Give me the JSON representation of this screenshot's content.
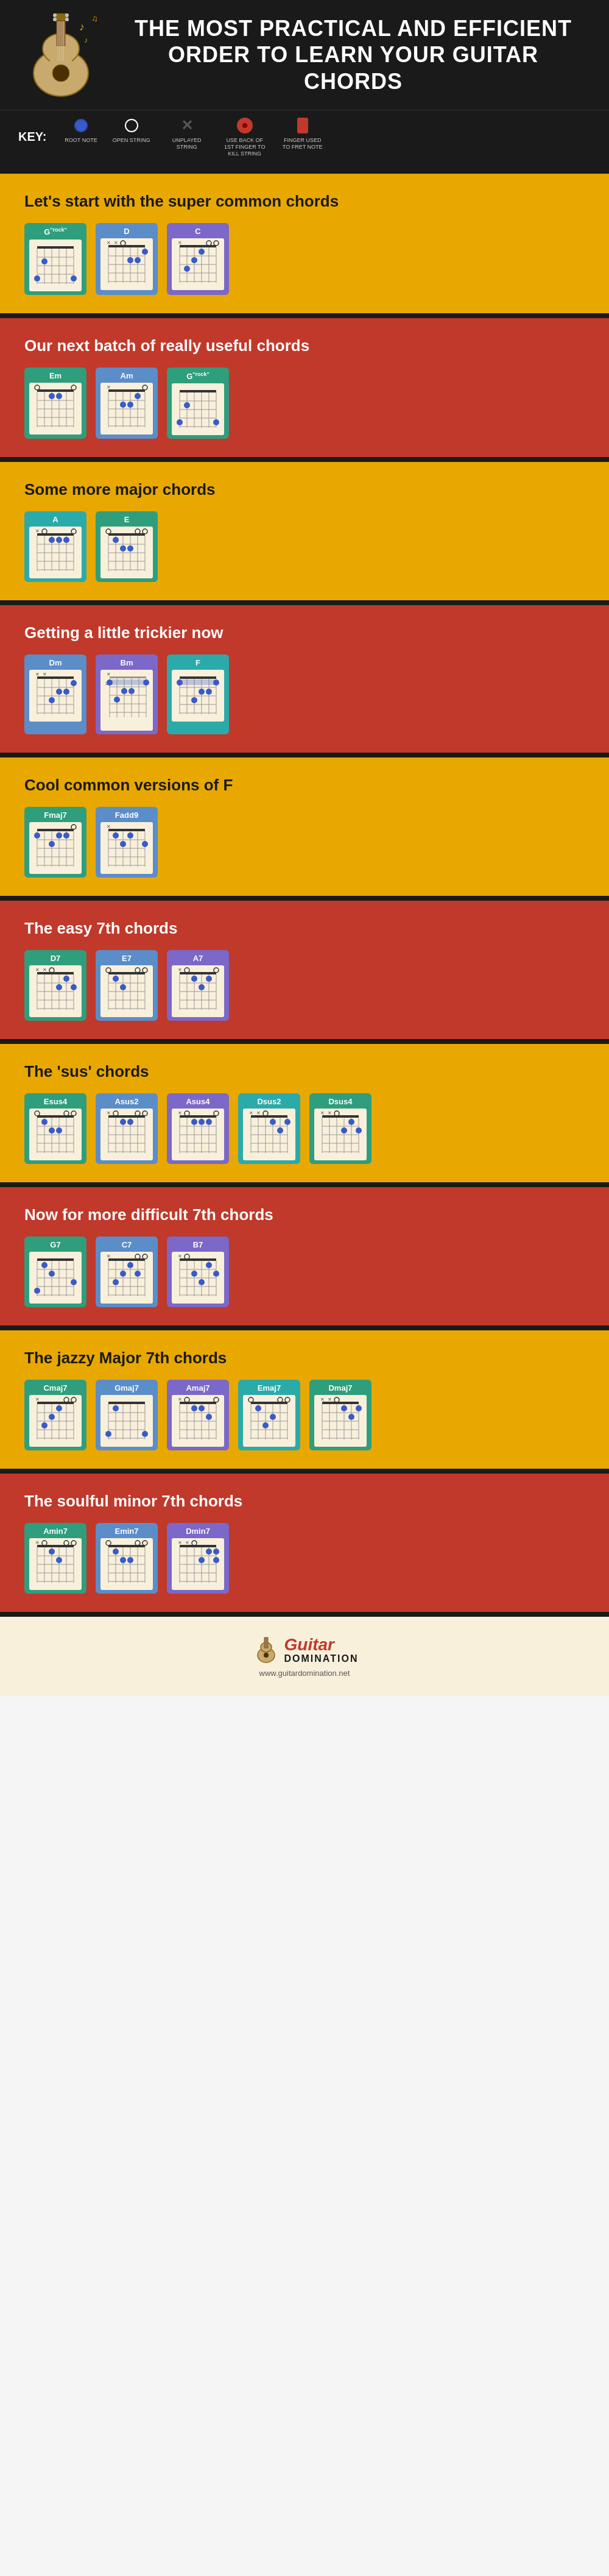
{
  "header": {
    "title": "THE MOST PRACTICAL AND EFFICIENT ORDER TO LEARN YOUR GUITAR CHORDS",
    "key_label": "KEY:"
  },
  "key_items": [
    {
      "id": "root-note",
      "type": "filled-circle",
      "desc": "ROOT NOTE"
    },
    {
      "id": "open-string",
      "type": "open-circle",
      "desc": "OPEN STRING"
    },
    {
      "id": "unplayed",
      "type": "x",
      "desc": "UNPLAYED STRING"
    },
    {
      "id": "kill-string",
      "type": "back-of-finger",
      "desc": "USE BACK OF 1ST FINGER TO KILL STRING"
    },
    {
      "id": "fret-note",
      "type": "finger",
      "desc": "FINGER USED TO FRET NOTE"
    }
  ],
  "sections": [
    {
      "id": "super-common",
      "style": "yellow",
      "title": "Let's start with the super common chords",
      "chords": [
        "G\"rok\"",
        "D",
        "C"
      ]
    },
    {
      "id": "really-useful",
      "style": "red",
      "title": "Our next batch of really useful chords",
      "chords": [
        "Em",
        "Am",
        "G\"rock\""
      ]
    },
    {
      "id": "major-chords",
      "style": "yellow",
      "title": "Some more major chords",
      "chords": [
        "A",
        "E"
      ]
    },
    {
      "id": "trickier",
      "style": "red",
      "title": "Getting a little trickier now",
      "chords": [
        "Dm",
        "Bm",
        "F"
      ]
    },
    {
      "id": "versions-f",
      "style": "yellow",
      "title": "Cool common versions of F",
      "chords": [
        "Fmaj7",
        "Fadd9"
      ]
    },
    {
      "id": "easy-7th",
      "style": "red",
      "title": "The easy 7th chords",
      "chords": [
        "D7",
        "E7",
        "A7"
      ]
    },
    {
      "id": "sus-chords",
      "style": "yellow",
      "title": "The 'sus' chords",
      "chords": [
        "Esus4",
        "Asus2",
        "Asus4",
        "Dsus2",
        "Dsus4"
      ]
    },
    {
      "id": "difficult-7th",
      "style": "red",
      "title": "Now for more difficult 7th chords",
      "chords": [
        "G7",
        "C7",
        "B7"
      ]
    },
    {
      "id": "jazzy-major7",
      "style": "yellow",
      "title": "The jazzy Major 7th chords",
      "chords": [
        "Cmaj7",
        "Gmaj7",
        "Amaj7",
        "Emaj7",
        "Dmaj7"
      ]
    },
    {
      "id": "soulful-minor7",
      "style": "red",
      "title": "The soulful minor 7th chords",
      "chords": [
        "Amin7",
        "Emin7",
        "Dmin7"
      ]
    }
  ],
  "footer": {
    "logo_text": "Guitar",
    "logo_suffix": "Domination",
    "url": "www.guitardomination.net"
  }
}
